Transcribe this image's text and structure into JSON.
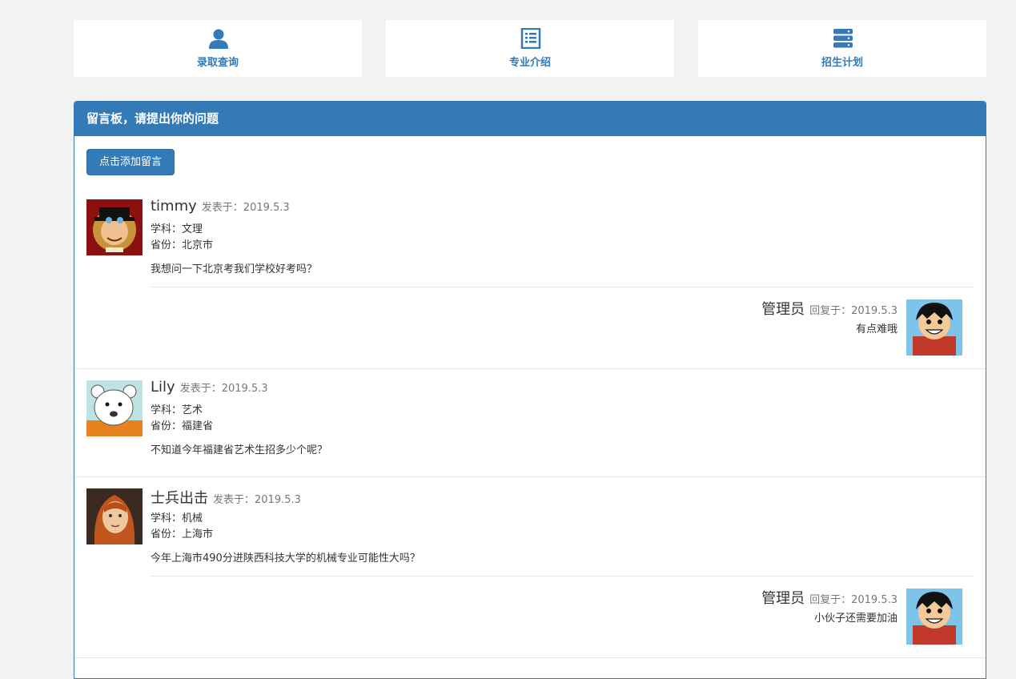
{
  "colors": {
    "primary": "#337ab7",
    "background": "#f2f2f2"
  },
  "tiles": [
    {
      "label": "录取查询",
      "icon": "user-icon"
    },
    {
      "label": "专业介绍",
      "icon": "list-icon"
    },
    {
      "label": "招生计划",
      "icon": "server-icon"
    }
  ],
  "panel": {
    "title": "留言板，请提出你的问题",
    "add_button": "点击添加留言"
  },
  "messages": [
    {
      "name": "timmy",
      "posted_label": "发表于：",
      "date": "2019.5.3",
      "subject": "学科：文理",
      "province": "省份：北京市",
      "content": "我想问一下北京考我们学校好考吗？",
      "reply": {
        "name": "管理员",
        "label": "回复于：",
        "date": "2019.5.3",
        "content": "有点难哦"
      }
    },
    {
      "name": "Lily",
      "posted_label": "发表于：",
      "date": "2019.5.3",
      "subject": "学科：艺术",
      "province": "省份：福建省",
      "content": "不知道今年福建省艺术生招多少个呢？"
    },
    {
      "name": "士兵出击",
      "posted_label": "发表于：",
      "date": "2019.5.3",
      "subject": "学科：机械",
      "province": "省份：上海市",
      "content": "今年上海市490分进陕西科技大学的机械专业可能性大吗？",
      "reply": {
        "name": "管理员",
        "label": "回复于：",
        "date": "2019.5.3",
        "content": "小伙子还需要加油"
      }
    }
  ]
}
